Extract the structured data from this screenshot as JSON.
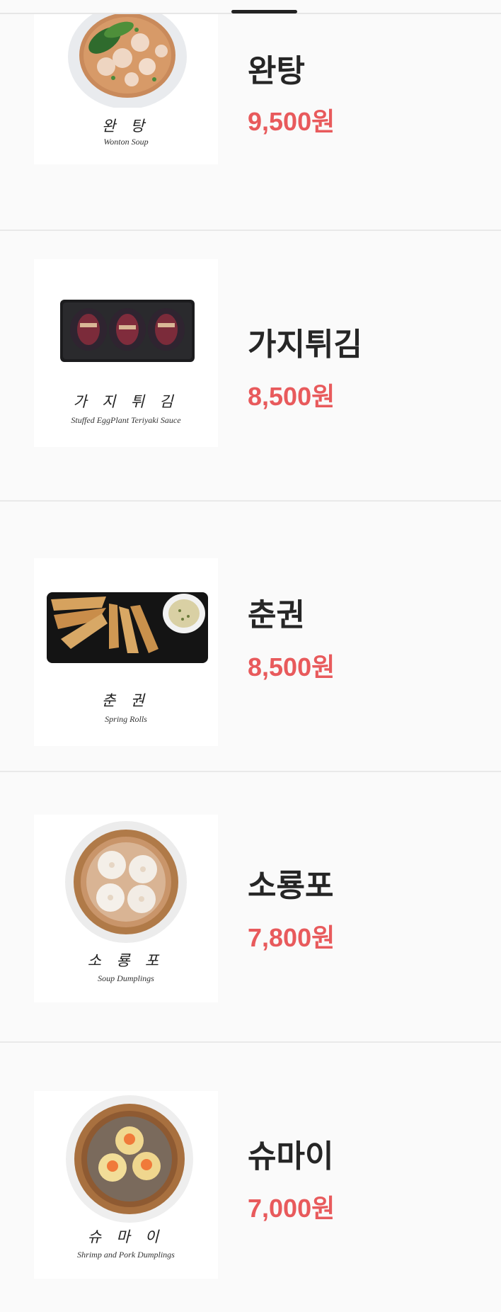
{
  "colors": {
    "price": "#e85a5c",
    "name": "#262626",
    "divider": "#e9e9e9"
  },
  "items": [
    {
      "name": "완탕",
      "price": "9,500원",
      "caption_ko": "완 탕",
      "caption_en": "Wonton Soup",
      "image": "wonton-soup-photo"
    },
    {
      "name": "가지튀김",
      "price": "8,500원",
      "caption_ko": "가 지 튀 김",
      "caption_en": "Stuffed EggPlant Teriyaki Sauce",
      "image": "eggplant-photo"
    },
    {
      "name": "춘권",
      "price": "8,500원",
      "caption_ko": "춘 권",
      "caption_en": "Spring Rolls",
      "image": "spring-rolls-photo"
    },
    {
      "name": "소룡포",
      "price": "7,800원",
      "caption_ko": "소 룡 포",
      "caption_en": "Soup Dumplings",
      "image": "soup-dumplings-photo"
    },
    {
      "name": "슈마이",
      "price": "7,000원",
      "caption_ko": "슈 마 이",
      "caption_en": "Shrimp and Pork Dumplings",
      "image": "shumai-photo"
    }
  ]
}
